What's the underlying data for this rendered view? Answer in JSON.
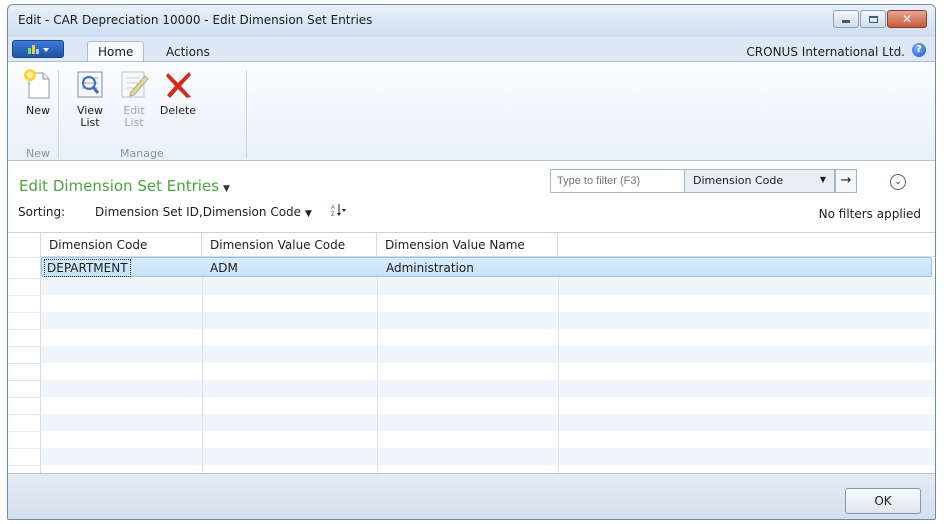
{
  "window": {
    "title": "Edit - CAR Depreciation 10000 - Edit Dimension Set Entries",
    "controls": [
      "minimize-icon",
      "maximize-icon",
      "close-icon"
    ]
  },
  "ribbon_tabs": {
    "app_menu_icon": "app-menu-icon",
    "home": "Home",
    "actions": "Actions",
    "company": "CRONUS International Ltd.",
    "help_icon": "help-icon",
    "help_glyph": "?"
  },
  "ribbon": {
    "new_label": "New",
    "view_list_label": "View List",
    "edit_list_label": "Edit List",
    "delete_label": "Delete",
    "group_new": "New",
    "group_manage": "Manage"
  },
  "page": {
    "title": "Edit Dimension Set Entries",
    "filter_placeholder": "Type to filter (F3)",
    "filter_field": "Dimension Code",
    "sorting_label": "Sorting:",
    "sorting_value": "Dimension Set ID,Dimension Code",
    "no_filters": "No filters applied"
  },
  "grid": {
    "columns": [
      "Dimension Code",
      "Dimension Value Code",
      "Dimension Value Name"
    ],
    "rows": [
      {
        "dimension_code": "DEPARTMENT",
        "dimension_value_code": "ADM",
        "dimension_value_name": "Administration"
      }
    ]
  },
  "footer": {
    "ok_label": "OK"
  },
  "colors": {
    "page_title": "#4ca33b",
    "selected_row": "#c5e2f8",
    "close_button": "#c75a3a"
  }
}
